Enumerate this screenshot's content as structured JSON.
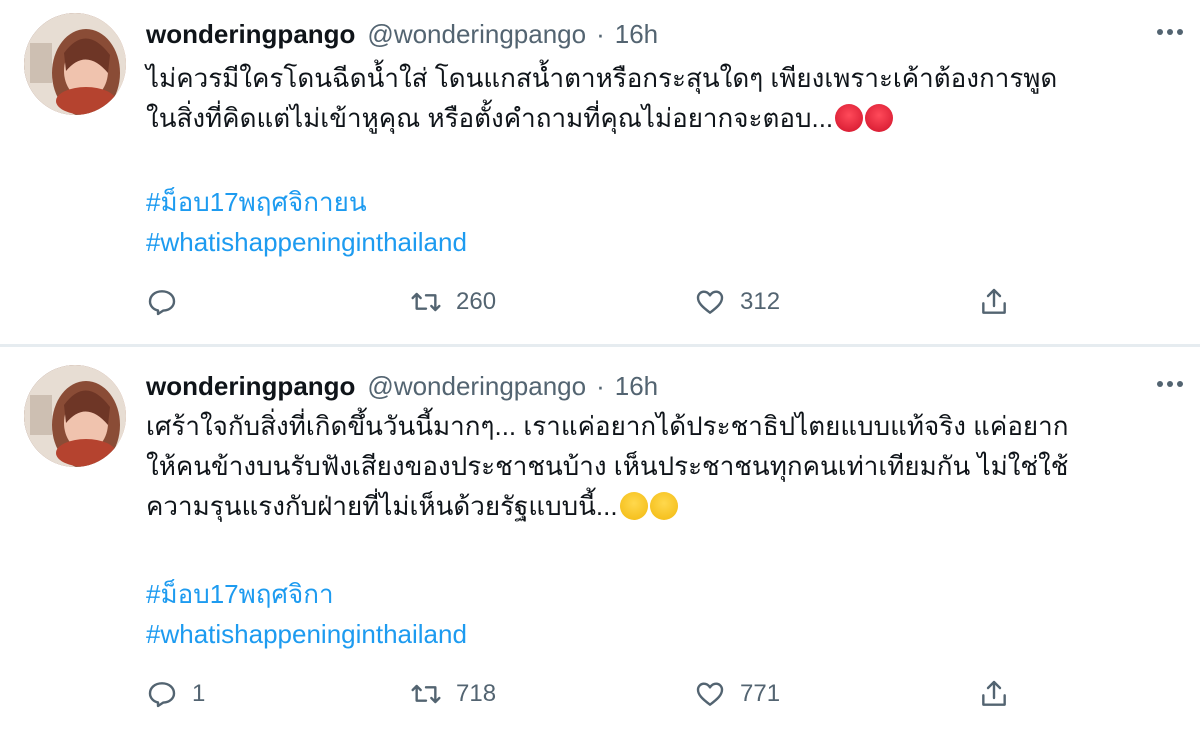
{
  "tweets": [
    {
      "name": "wonderingpango",
      "handle": "@wonderingpango",
      "separator": "·",
      "time": "16h",
      "text_lines": [
        "ไม่ควรมีใครโดนฉีดน้ำใส่ โดนแกสน้ำตาหรือกระสุนใดๆ เพียงเพราะเค้าต้องการพูด",
        "ในสิ่งที่คิดแต่ไม่เข้าหูคุณ หรือตั้งคำถามที่คุณไม่อยากจะตอบ..."
      ],
      "emoji": "angry-face-emoji",
      "hashtags": [
        "#ม็อบ17พฤศจิกายน",
        "#whatishappeninginthailand"
      ],
      "replies": "",
      "retweets": "260",
      "likes": "312"
    },
    {
      "name": "wonderingpango",
      "handle": "@wonderingpango",
      "separator": "·",
      "time": "16h",
      "text_lines": [
        "เศร้าใจกับสิ่งที่เกิดขึ้นวันนี้มากๆ... เราแค่อยากได้ประชาธิปไตยแบบแท้จริง แค่อยาก",
        "ให้คนข้างบนรับฟังเสียงของประชาชนบ้าง เห็นประชาชนทุกคนเท่าเทียมกัน ไม่ใช่ใช้",
        "ความรุนแรงกับฝ่ายที่ไม่เห็นด้วยรัฐแบบนี้..."
      ],
      "emoji": "sad-face-emoji",
      "hashtags": [
        "#ม็อบ17พฤศจิกา",
        "#whatishappeninginthailand"
      ],
      "replies": "1",
      "retweets": "718",
      "likes": "771"
    }
  ],
  "colors": {
    "link": "#1d9bf0",
    "secondary_text": "#536471",
    "divider": "#e6ecf0"
  },
  "icons": [
    "avatar",
    "more-icon",
    "reply-icon",
    "retweet-icon",
    "like-icon",
    "share-icon"
  ]
}
